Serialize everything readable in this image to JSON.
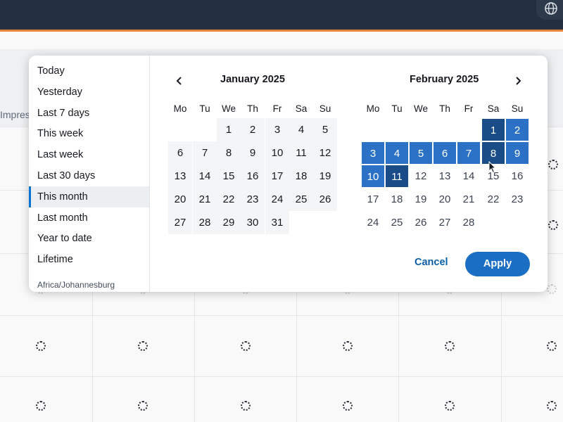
{
  "colors": {
    "topbar": "#232f3e",
    "accent": "#e8833a",
    "range": "#2b72c6",
    "range_edge": "#1a4c88",
    "primary": "#1a6fc4",
    "link": "#0a5ea8"
  },
  "header": {
    "globe_icon": "globe-icon"
  },
  "table": {
    "first_column_label": "Impres"
  },
  "presets": {
    "items": [
      "Today",
      "Yesterday",
      "Last 7 days",
      "This week",
      "Last week",
      "Last 30 days",
      "This month",
      "Last month",
      "Year to date",
      "Lifetime"
    ],
    "selected": "This month",
    "timezone": "Africa/Johannesburg"
  },
  "calendar": {
    "weekdays": [
      "Mo",
      "Tu",
      "We",
      "Th",
      "Fr",
      "Sa",
      "Su"
    ],
    "left": {
      "title": "January 2025",
      "days": [
        [
          "",
          "",
          "1",
          "2",
          "3",
          "4",
          "5"
        ],
        [
          "6",
          "7",
          "8",
          "9",
          "10",
          "11",
          "12"
        ],
        [
          "13",
          "14",
          "15",
          "16",
          "17",
          "18",
          "19"
        ],
        [
          "20",
          "21",
          "22",
          "23",
          "24",
          "25",
          "26"
        ],
        [
          "27",
          "28",
          "29",
          "30",
          "31",
          "",
          ""
        ]
      ]
    },
    "right": {
      "title": "February 2025",
      "days": [
        [
          "",
          "",
          "",
          "",
          "",
          "1",
          "2"
        ],
        [
          "3",
          "4",
          "5",
          "6",
          "7",
          "8",
          "9"
        ],
        [
          "10",
          "11",
          "12",
          "13",
          "14",
          "15",
          "16"
        ],
        [
          "17",
          "18",
          "19",
          "20",
          "21",
          "22",
          "23"
        ],
        [
          "24",
          "25",
          "26",
          "27",
          "28",
          "",
          ""
        ]
      ],
      "range_start": "1",
      "range_end": "11",
      "highlighted_edges": [
        "1",
        "8",
        "11"
      ]
    }
  },
  "actions": {
    "cancel_label": "Cancel",
    "apply_label": "Apply"
  }
}
